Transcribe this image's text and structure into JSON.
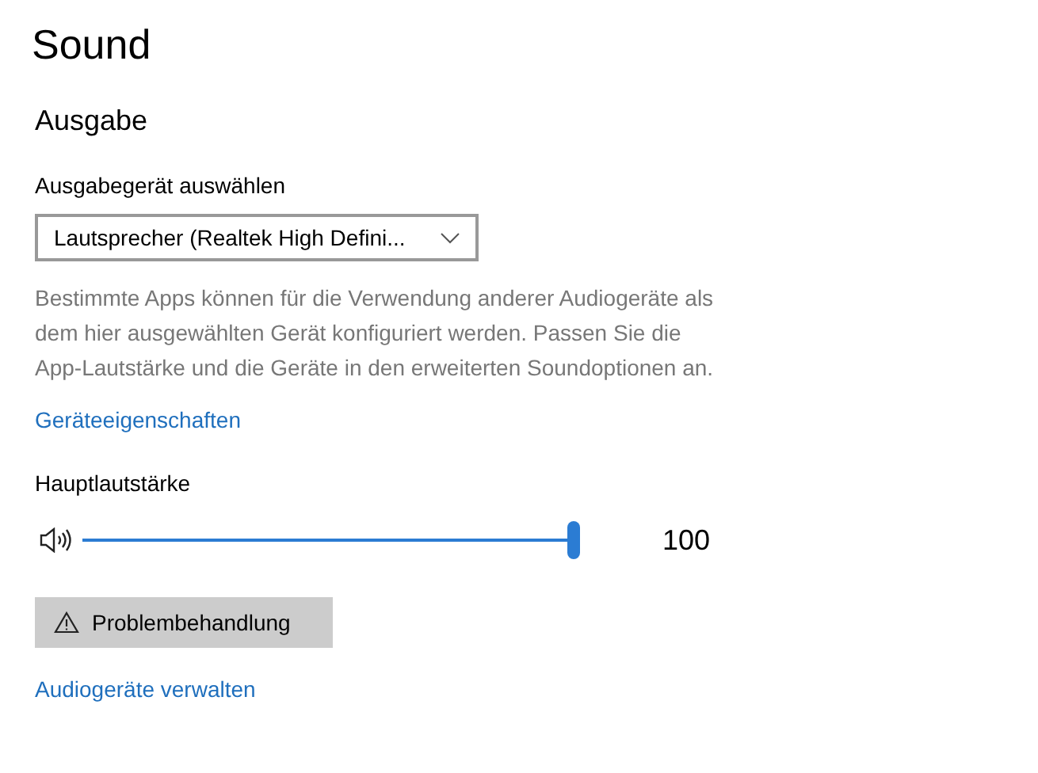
{
  "page": {
    "title": "Sound"
  },
  "section": {
    "heading": "Ausgabe"
  },
  "output_device": {
    "label": "Ausgabegerät auswählen",
    "value": "Lautsprecher (Realtek High Defini..."
  },
  "description": "Bestimmte Apps können für die Verwendung anderer Audiogeräte als dem hier ausgewählten Gerät konfiguriert werden. Passen Sie die App-Lautstärke und die Geräte in den erweiterten Soundoptionen an.",
  "device_properties_link": "Geräteeigenschaften",
  "master_volume": {
    "label": "Hauptlautstärke",
    "level": 1.0,
    "reading": "100"
  },
  "troubleshoot_button": "Problembehandlung",
  "manage_devices_link": "Audiogeräte verwalten"
}
